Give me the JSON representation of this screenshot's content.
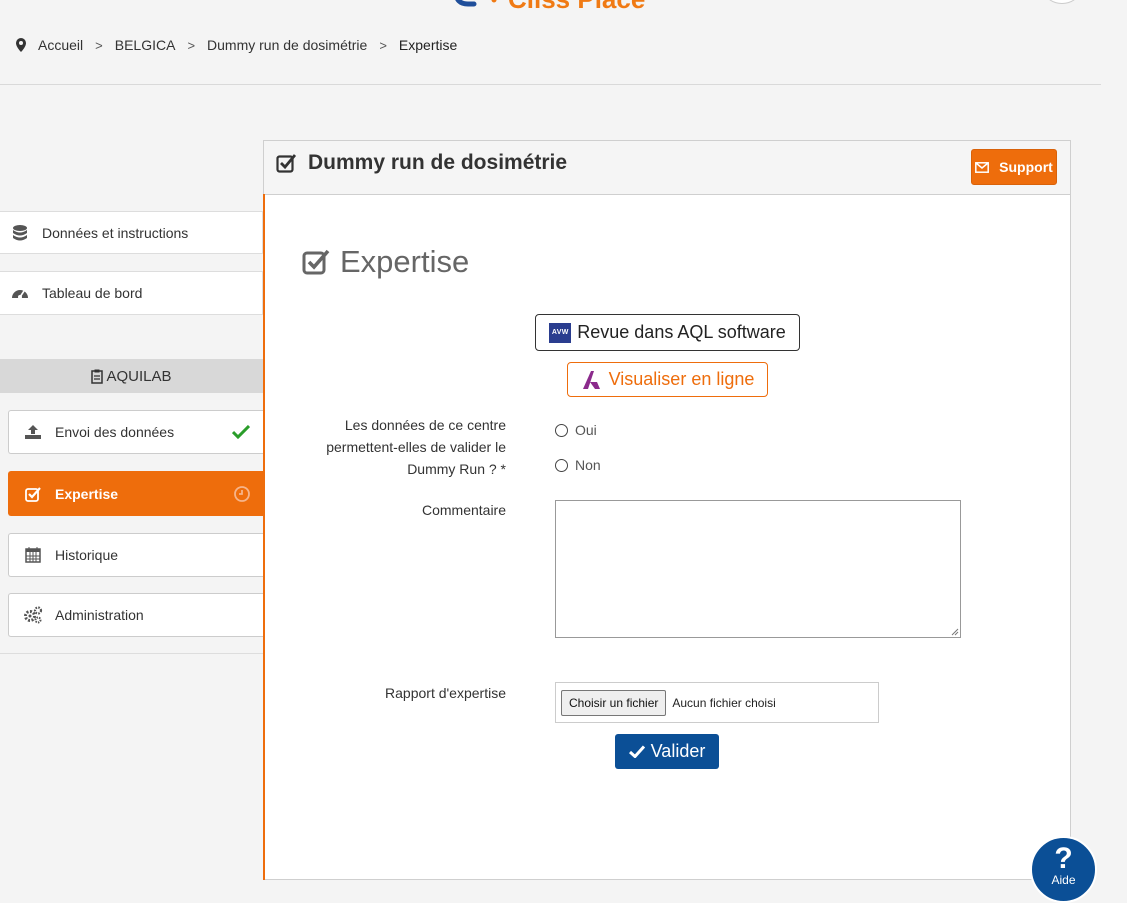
{
  "header": {
    "logo_text": "Cliss Place"
  },
  "breadcrumb": {
    "items": [
      "Accueil",
      "BELGICA",
      "Dummy run de dosimétrie"
    ],
    "current": "Expertise",
    "separator": ">"
  },
  "sidebar": {
    "top_items": [
      {
        "label": "Données et instructions",
        "icon": "database-icon"
      },
      {
        "label": "Tableau de bord",
        "icon": "dashboard-icon"
      }
    ],
    "group_label": "AQUILAB",
    "nav": [
      {
        "label": "Envoi des données",
        "icon": "upload-icon",
        "status": "done"
      },
      {
        "label": "Expertise",
        "icon": "check-square-icon",
        "status": "pending",
        "active": true
      },
      {
        "label": "Historique",
        "icon": "calendar-icon"
      },
      {
        "label": "Administration",
        "icon": "gears-icon"
      }
    ]
  },
  "panel": {
    "title": "Dummy run de dosimétrie",
    "support_label": "Support",
    "section_title": "Expertise",
    "aql_button": "Revue dans AQL software",
    "aql_badge": "AVW",
    "visualize_button": "Visualiser en ligne",
    "question_label": "Les données de ce centre permettent-elles de valider le Dummy Run ? *",
    "options": [
      "Oui",
      "Non"
    ],
    "comment_label": "Commentaire",
    "comment_value": "",
    "report_label": "Rapport d'expertise",
    "file_button": "Choisir un fichier",
    "file_status": "Aucun fichier choisi",
    "submit_label": "Valider"
  },
  "help": {
    "label": "Aide",
    "symbol": "?"
  },
  "colors": {
    "accent": "#ee6d0c",
    "primary": "#0b4f96",
    "success": "#2a9d2a"
  }
}
